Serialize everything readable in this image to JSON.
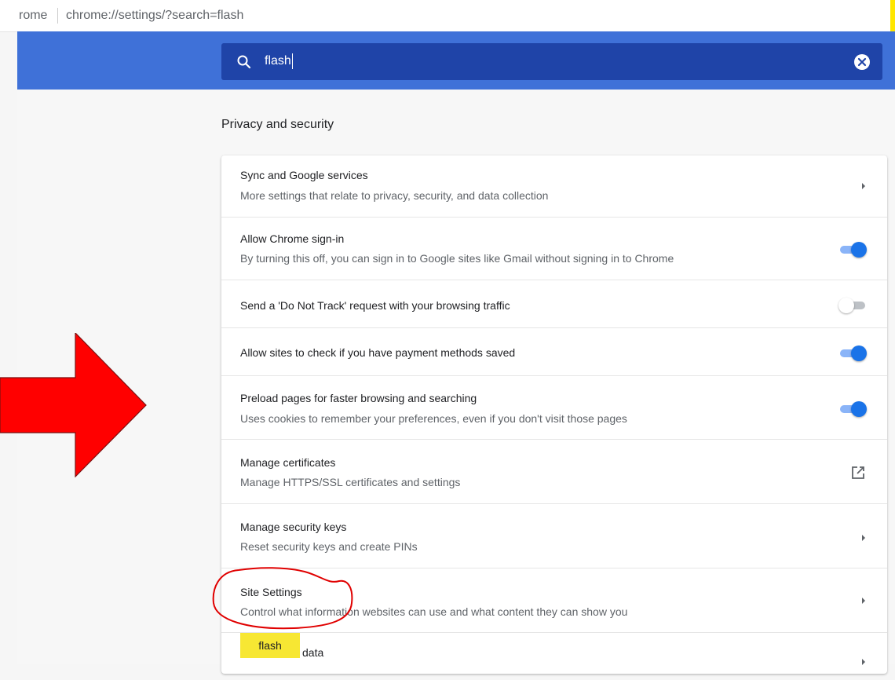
{
  "address_bar": {
    "site_fragment": "rome",
    "url": "chrome://settings/?search=flash"
  },
  "search": {
    "value": "flash"
  },
  "section": {
    "title": "Privacy and security"
  },
  "rows": [
    {
      "title": "Sync and Google services",
      "subtitle": "More settings that relate to privacy, security, and data collection",
      "control": "arrow"
    },
    {
      "title": "Allow Chrome sign-in",
      "subtitle": "By turning this off, you can sign in to Google sites like Gmail without signing in to Chrome",
      "control": "toggle",
      "on": true
    },
    {
      "title": "Send a 'Do Not Track' request with your browsing traffic",
      "subtitle": "",
      "control": "toggle",
      "on": false
    },
    {
      "title": "Allow sites to check if you have payment methods saved",
      "subtitle": "",
      "control": "toggle",
      "on": true
    },
    {
      "title": "Preload pages for faster browsing and searching",
      "subtitle": "Uses cookies to remember your preferences, even if you don't visit those pages",
      "control": "toggle",
      "on": true
    },
    {
      "title": "Manage certificates",
      "subtitle": "Manage HTTPS/SSL certificates and settings",
      "control": "external-link"
    },
    {
      "title": "Manage security keys",
      "subtitle": "Reset security keys and create PINs",
      "control": "arrow"
    },
    {
      "title": "Site Settings",
      "subtitle": "Control what information websites can use and what content they can show you",
      "control": "arrow"
    }
  ],
  "partial_row": {
    "highlight": "flash",
    "visible_text": "data"
  },
  "colors": {
    "header_blue": "#3f71d8",
    "search_dark": "#1f44a8",
    "toggle_on": "#1a73e8",
    "annotation_red": "#ff0000",
    "highlight_yellow": "#f7e733"
  }
}
